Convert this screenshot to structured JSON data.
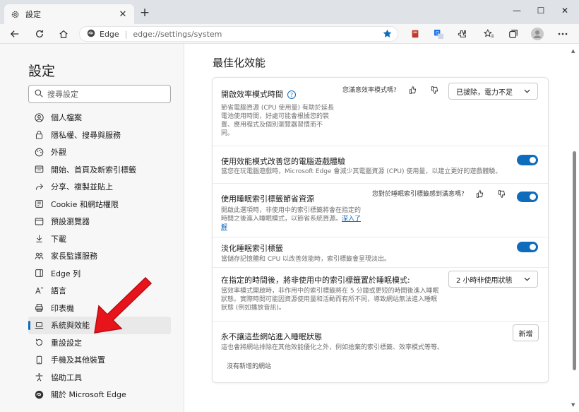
{
  "tab": {
    "title": "設定"
  },
  "address": {
    "site": "Edge",
    "url": "edge://settings/system"
  },
  "sidebar": {
    "title": "設定",
    "search_placeholder": "搜尋設定",
    "items": [
      {
        "label": "個人檔案",
        "icon": "profile-icon"
      },
      {
        "label": "隱私權、搜尋與服務",
        "icon": "lock-icon"
      },
      {
        "label": "外觀",
        "icon": "appearance-icon"
      },
      {
        "label": "開始、首頁及新索引標籤",
        "icon": "home-tab-icon"
      },
      {
        "label": "分享、複製並貼上",
        "icon": "share-icon"
      },
      {
        "label": "Cookie 和網站權限",
        "icon": "cookie-icon"
      },
      {
        "label": "預設瀏覽器",
        "icon": "browser-icon"
      },
      {
        "label": "下載",
        "icon": "download-icon"
      },
      {
        "label": "家長監護服務",
        "icon": "family-icon"
      },
      {
        "label": "Edge 列",
        "icon": "edge-bar-icon"
      },
      {
        "label": "語言",
        "icon": "language-icon"
      },
      {
        "label": "印表機",
        "icon": "printer-icon"
      },
      {
        "label": "系統與效能",
        "icon": "laptop-icon"
      },
      {
        "label": "重設設定",
        "icon": "reset-icon"
      },
      {
        "label": "手機及其他裝置",
        "icon": "phone-icon"
      },
      {
        "label": "協助工具",
        "icon": "accessibility-icon"
      },
      {
        "label": "關於 Microsoft Edge",
        "icon": "edge-logo-icon"
      }
    ]
  },
  "main": {
    "title": "最佳化效能",
    "efficiency": {
      "title": "開啟效率模式時間",
      "desc": [
        "節省電腦資源 (CPU 使用量) 有助於延長",
        "電池使用時間，好處可能會根據您的裝",
        "置、應用程式及個別瀏覽器習慣而不",
        "同。"
      ],
      "feedback": "您滿意效率模式嗎?",
      "value": "已拔除，電力不足"
    },
    "gaming": {
      "title": "使用效能模式改善您的電腦遊戲體驗",
      "desc": "當您在玩電腦遊戲時，Microsoft Edge 會減少其電腦資源 (CPU) 使用量，以建立更好的遊戲體驗。"
    },
    "sleeping": {
      "title": "使用睡眠索引標籤節省資源",
      "desc": [
        "開啟此選項時，非使用中的索引標籤將會在指定的",
        "時間之後進入睡眠模式，以節省系統資源。"
      ],
      "link1": "深入了",
      "link2": "解",
      "feedback": "您對於睡眠索引標籤感到滿意嗎?"
    },
    "fade": {
      "title": "淡化睡眠索引標籤",
      "desc": "當儲存記憶體和 CPU 以改善效能時，索引標籤會呈現淡出。"
    },
    "sleep_time": {
      "title": "在指定的時間後，將非使用中的索引標籤置於睡眠模式:",
      "desc": [
        "當效率模式開啟時，非作用中的索引標籤將在 5 分鐘或更短的時間後進入睡眠",
        "狀態。實際時間可能因資源使用量和活動而有所不同，導致網站無法進入睡眠",
        "狀態 (例如播放音訊)。"
      ],
      "value": "2 小時非使用狀態"
    },
    "never_sleep": {
      "title": "永不讓這些網站進入睡眠狀態",
      "desc": "這也會將網站排除在其他效能優化之外，例如捨棄的索引標籤、效率模式等等。",
      "add_label": "新增",
      "empty": "沒有新增的網站"
    }
  },
  "colors": {
    "accent": "#0f6cbd",
    "arrow": "#e8141c"
  }
}
